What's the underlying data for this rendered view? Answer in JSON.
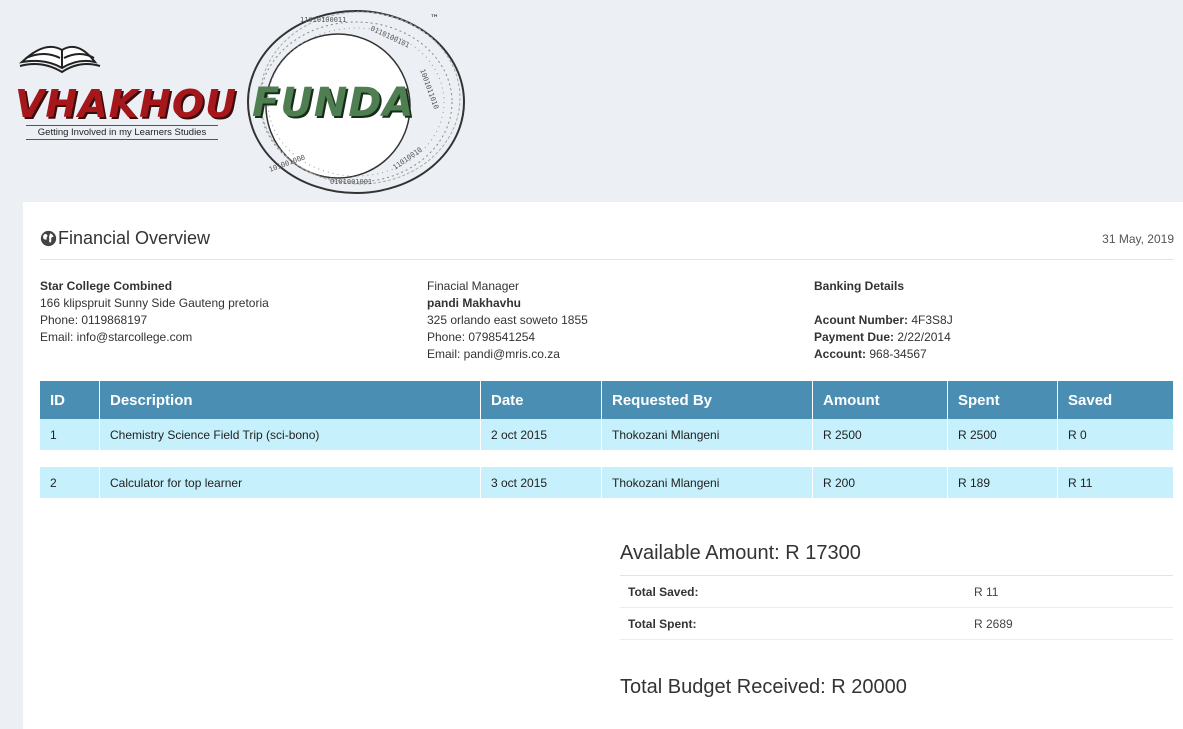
{
  "logo": {
    "left_word": "VHAKHOU",
    "right_word": "FUNDA",
    "tagline": "Getting Involved in my Learners Studies",
    "trademark": "™",
    "colors": {
      "left": "#a6171b",
      "right": "#4f7e52"
    }
  },
  "header": {
    "icon": "globe-icon",
    "title": "Financial Overview",
    "date": "31 May, 2019"
  },
  "school": {
    "name": "Star College Combined",
    "address": "166 klipspruit Sunny Side Gauteng pretoria",
    "phone": "Phone: 0119868197",
    "email": "Email: info@starcollege.com"
  },
  "manager": {
    "role": "Finacial Manager",
    "name": "pandi Makhavhu",
    "address": "325 orlando east soweto 1855",
    "phone": "Phone: 0798541254",
    "email": "Email: pandi@mris.co.za"
  },
  "banking": {
    "title": "Banking Details",
    "account_number_label": "Acount Number:",
    "account_number": "4F3S8J",
    "payment_due_label": "Payment Due:",
    "payment_due": "2/22/2014",
    "account_label": "Account:",
    "account": "968-34567"
  },
  "table": {
    "columns": [
      "ID",
      "Description",
      "Date",
      "Requested By",
      "Amount",
      "Spent",
      "Saved"
    ],
    "rows": [
      [
        "1",
        "Chemistry Science Field Trip (sci-bono)",
        "2 oct 2015",
        "Thokozani Mlangeni",
        "R 2500",
        "R 2500",
        "R 0"
      ],
      [
        "2",
        "Calculator for top learner",
        "3 oct 2015",
        "Thokozani Mlangeni",
        "R 200",
        "R 189",
        "R 11"
      ]
    ],
    "colors": {
      "header": "#4a8eb4",
      "row": "#c6f0fb"
    }
  },
  "summary": {
    "available": "Available Amount: R 17300",
    "saved_label": "Total Saved:",
    "saved_value": "R 11",
    "spent_label": "Total Spent:",
    "spent_value": "R 2689",
    "budget": "Total Budget Received: R 20000"
  }
}
